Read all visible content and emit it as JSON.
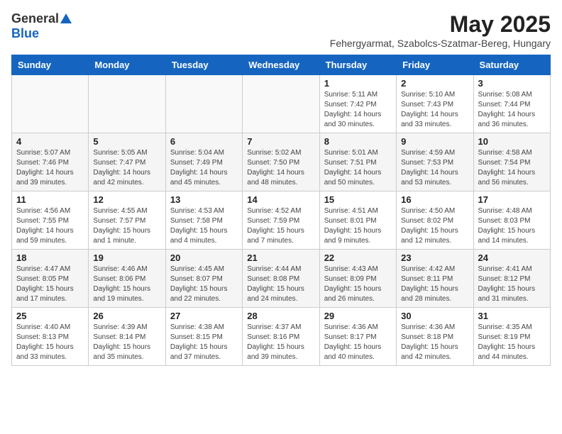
{
  "header": {
    "logo_general": "General",
    "logo_blue": "Blue",
    "month_title": "May 2025",
    "location": "Fehergyarmat, Szabolcs-Szatmar-Bereg, Hungary"
  },
  "weekdays": [
    "Sunday",
    "Monday",
    "Tuesday",
    "Wednesday",
    "Thursday",
    "Friday",
    "Saturday"
  ],
  "weeks": [
    [
      {
        "day": "",
        "info": ""
      },
      {
        "day": "",
        "info": ""
      },
      {
        "day": "",
        "info": ""
      },
      {
        "day": "",
        "info": ""
      },
      {
        "day": "1",
        "info": "Sunrise: 5:11 AM\nSunset: 7:42 PM\nDaylight: 14 hours\nand 30 minutes."
      },
      {
        "day": "2",
        "info": "Sunrise: 5:10 AM\nSunset: 7:43 PM\nDaylight: 14 hours\nand 33 minutes."
      },
      {
        "day": "3",
        "info": "Sunrise: 5:08 AM\nSunset: 7:44 PM\nDaylight: 14 hours\nand 36 minutes."
      }
    ],
    [
      {
        "day": "4",
        "info": "Sunrise: 5:07 AM\nSunset: 7:46 PM\nDaylight: 14 hours\nand 39 minutes."
      },
      {
        "day": "5",
        "info": "Sunrise: 5:05 AM\nSunset: 7:47 PM\nDaylight: 14 hours\nand 42 minutes."
      },
      {
        "day": "6",
        "info": "Sunrise: 5:04 AM\nSunset: 7:49 PM\nDaylight: 14 hours\nand 45 minutes."
      },
      {
        "day": "7",
        "info": "Sunrise: 5:02 AM\nSunset: 7:50 PM\nDaylight: 14 hours\nand 48 minutes."
      },
      {
        "day": "8",
        "info": "Sunrise: 5:01 AM\nSunset: 7:51 PM\nDaylight: 14 hours\nand 50 minutes."
      },
      {
        "day": "9",
        "info": "Sunrise: 4:59 AM\nSunset: 7:53 PM\nDaylight: 14 hours\nand 53 minutes."
      },
      {
        "day": "10",
        "info": "Sunrise: 4:58 AM\nSunset: 7:54 PM\nDaylight: 14 hours\nand 56 minutes."
      }
    ],
    [
      {
        "day": "11",
        "info": "Sunrise: 4:56 AM\nSunset: 7:55 PM\nDaylight: 14 hours\nand 59 minutes."
      },
      {
        "day": "12",
        "info": "Sunrise: 4:55 AM\nSunset: 7:57 PM\nDaylight: 15 hours\nand 1 minute."
      },
      {
        "day": "13",
        "info": "Sunrise: 4:53 AM\nSunset: 7:58 PM\nDaylight: 15 hours\nand 4 minutes."
      },
      {
        "day": "14",
        "info": "Sunrise: 4:52 AM\nSunset: 7:59 PM\nDaylight: 15 hours\nand 7 minutes."
      },
      {
        "day": "15",
        "info": "Sunrise: 4:51 AM\nSunset: 8:01 PM\nDaylight: 15 hours\nand 9 minutes."
      },
      {
        "day": "16",
        "info": "Sunrise: 4:50 AM\nSunset: 8:02 PM\nDaylight: 15 hours\nand 12 minutes."
      },
      {
        "day": "17",
        "info": "Sunrise: 4:48 AM\nSunset: 8:03 PM\nDaylight: 15 hours\nand 14 minutes."
      }
    ],
    [
      {
        "day": "18",
        "info": "Sunrise: 4:47 AM\nSunset: 8:05 PM\nDaylight: 15 hours\nand 17 minutes."
      },
      {
        "day": "19",
        "info": "Sunrise: 4:46 AM\nSunset: 8:06 PM\nDaylight: 15 hours\nand 19 minutes."
      },
      {
        "day": "20",
        "info": "Sunrise: 4:45 AM\nSunset: 8:07 PM\nDaylight: 15 hours\nand 22 minutes."
      },
      {
        "day": "21",
        "info": "Sunrise: 4:44 AM\nSunset: 8:08 PM\nDaylight: 15 hours\nand 24 minutes."
      },
      {
        "day": "22",
        "info": "Sunrise: 4:43 AM\nSunset: 8:09 PM\nDaylight: 15 hours\nand 26 minutes."
      },
      {
        "day": "23",
        "info": "Sunrise: 4:42 AM\nSunset: 8:11 PM\nDaylight: 15 hours\nand 28 minutes."
      },
      {
        "day": "24",
        "info": "Sunrise: 4:41 AM\nSunset: 8:12 PM\nDaylight: 15 hours\nand 31 minutes."
      }
    ],
    [
      {
        "day": "25",
        "info": "Sunrise: 4:40 AM\nSunset: 8:13 PM\nDaylight: 15 hours\nand 33 minutes."
      },
      {
        "day": "26",
        "info": "Sunrise: 4:39 AM\nSunset: 8:14 PM\nDaylight: 15 hours\nand 35 minutes."
      },
      {
        "day": "27",
        "info": "Sunrise: 4:38 AM\nSunset: 8:15 PM\nDaylight: 15 hours\nand 37 minutes."
      },
      {
        "day": "28",
        "info": "Sunrise: 4:37 AM\nSunset: 8:16 PM\nDaylight: 15 hours\nand 39 minutes."
      },
      {
        "day": "29",
        "info": "Sunrise: 4:36 AM\nSunset: 8:17 PM\nDaylight: 15 hours\nand 40 minutes."
      },
      {
        "day": "30",
        "info": "Sunrise: 4:36 AM\nSunset: 8:18 PM\nDaylight: 15 hours\nand 42 minutes."
      },
      {
        "day": "31",
        "info": "Sunrise: 4:35 AM\nSunset: 8:19 PM\nDaylight: 15 hours\nand 44 minutes."
      }
    ]
  ]
}
